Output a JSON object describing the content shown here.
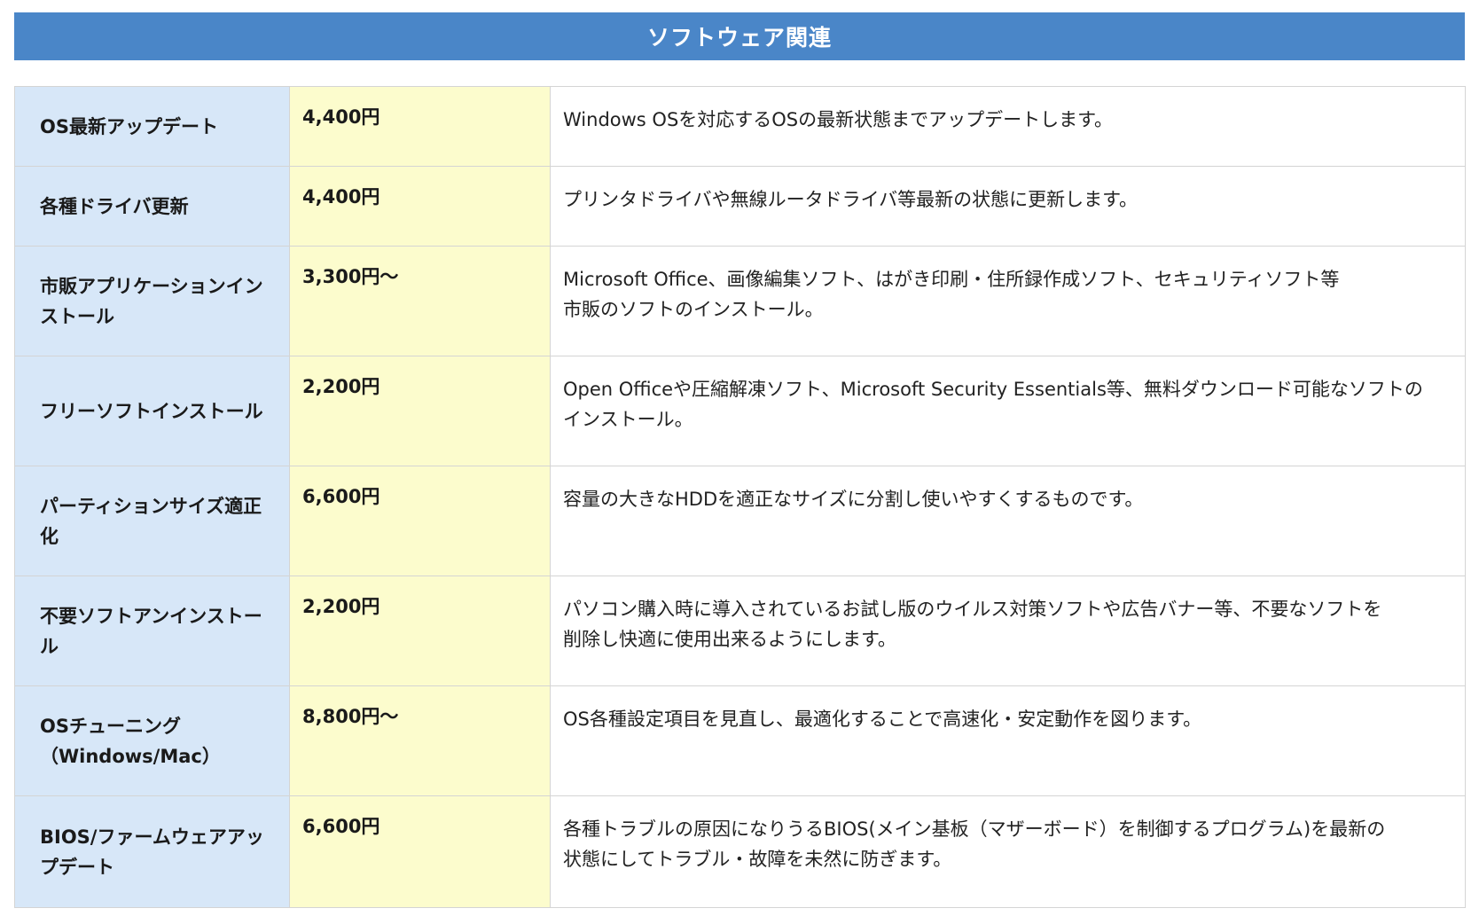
{
  "section": {
    "title": "ソフトウェア関連"
  },
  "colors": {
    "header_bg": "#4a86c8",
    "name_col_bg": "#d7e7f8",
    "price_col_bg": "#fcfccd"
  },
  "rows": [
    {
      "name": "OS最新アップデート",
      "price": "4,400円",
      "desc": [
        "Windows OSを対応するOSの最新状態までアップデートします。"
      ]
    },
    {
      "name": "各種ドライバ更新",
      "price": "4,400円",
      "desc": [
        "プリンタドライバや無線ルータドライバ等最新の状態に更新します。"
      ]
    },
    {
      "name": "市販アプリケーションインストール",
      "price": "3,300円〜",
      "desc": [
        "Microsoft Office、画像編集ソフト、はがき印刷・住所録作成ソフト、セキュリティソフト等",
        "市販のソフトのインストール。"
      ]
    },
    {
      "name": "フリーソフトインストール",
      "price": "2,200円",
      "desc": [
        "Open Officeや圧縮解凍ソフト、Microsoft Security Essentials等、無料ダウンロード可能なソフトの",
        "インストール。"
      ]
    },
    {
      "name": "パーティションサイズ適正化",
      "price": "6,600円",
      "desc": [
        "容量の大きなHDDを適正なサイズに分割し使いやすくするものです。"
      ]
    },
    {
      "name": "不要ソフトアンインストール",
      "price": "2,200円",
      "desc": [
        "パソコン購入時に導入されているお試し版のウイルス対策ソフトや広告バナー等、不要なソフトを",
        "削除し快適に使用出来るようにします。"
      ]
    },
    {
      "name": "OSチューニング（Windows/Mac）",
      "price": "8,800円〜",
      "desc": [
        "OS各種設定項目を見直し、最適化することで高速化・安定動作を図ります。"
      ]
    },
    {
      "name": "BIOS/ファームウェアアップデート",
      "price": "6,600円",
      "desc": [
        "各種トラブルの原因になりうるBIOS(メイン基板（マザーボード）を制御するプログラム)を最新の",
        "状態にしてトラブル・故障を未然に防ぎます。"
      ]
    }
  ]
}
